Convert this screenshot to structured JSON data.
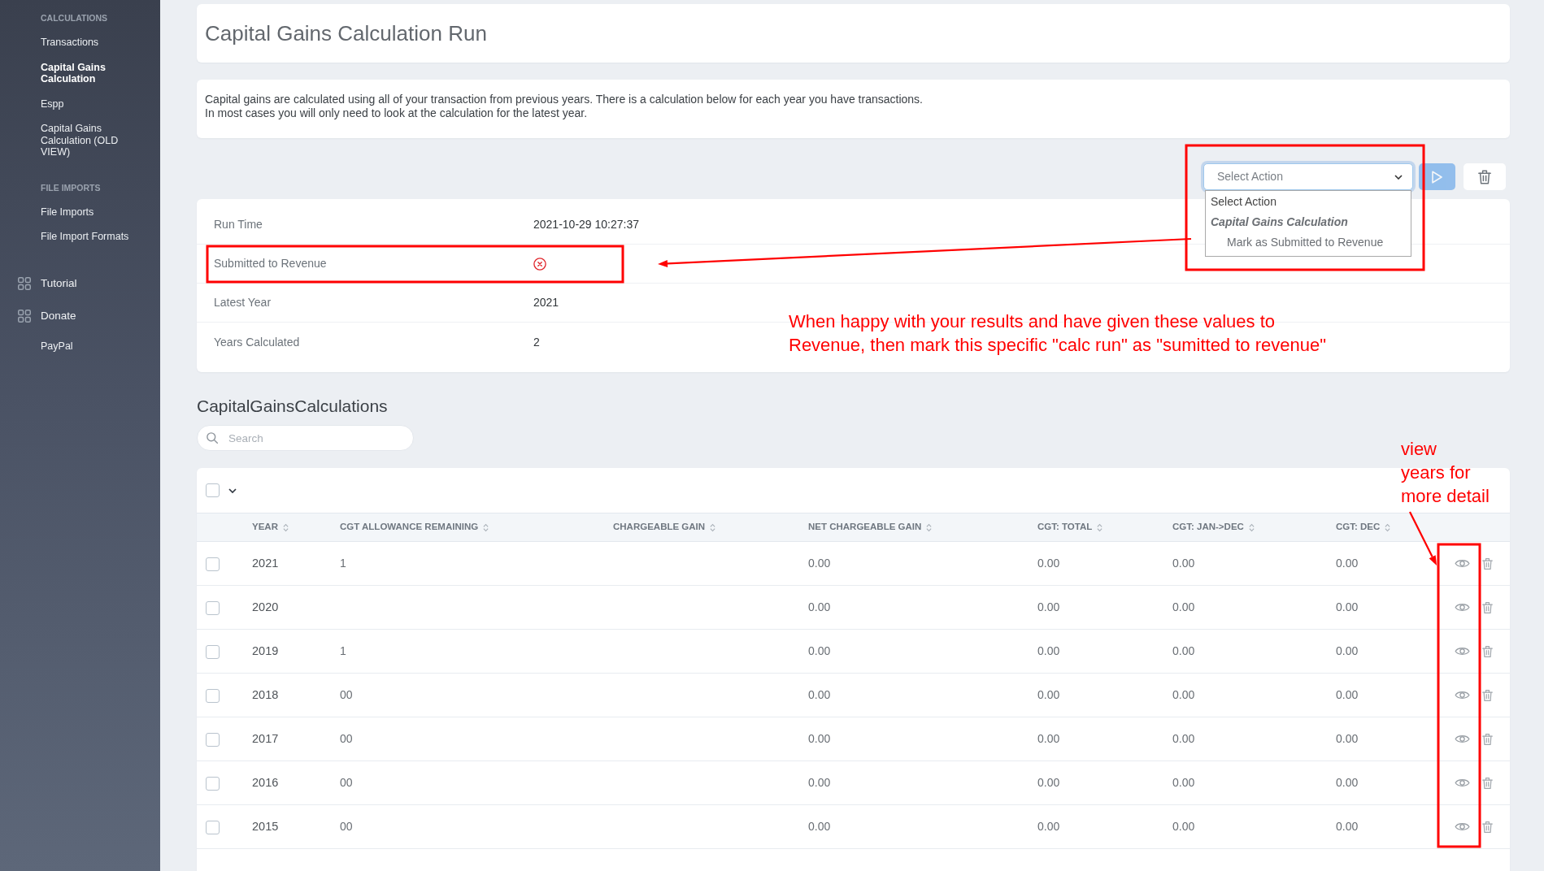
{
  "sidebar": {
    "sections": [
      {
        "heading": "CALCULATIONS",
        "items": [
          {
            "label": "Transactions",
            "selected": false
          },
          {
            "label": "Capital Gains Calculation",
            "selected": true
          },
          {
            "label": "Espp",
            "selected": false
          },
          {
            "label": "Capital Gains Calculation (OLD VIEW)",
            "selected": false
          }
        ]
      },
      {
        "heading": "FILE IMPORTS",
        "items": [
          {
            "label": "File Imports",
            "selected": false
          },
          {
            "label": "File Import Formats",
            "selected": false
          }
        ]
      }
    ],
    "menu": [
      {
        "label": "Tutorial",
        "selected": false
      },
      {
        "label": "Donate",
        "selected": false,
        "children": [
          {
            "label": "PayPal",
            "selected": false
          }
        ]
      }
    ]
  },
  "page_title": "Capital Gains Calculation Run",
  "description_lines": [
    "Capital gains are calculated using all of your transaction from previous years. There is a calculation below for each year you have transactions.",
    "In most cases you will only need to look at the calculation for the latest year."
  ],
  "action_bar": {
    "select": {
      "placeholder": "Select Action",
      "focused": true,
      "open": true,
      "options": [
        {
          "kind": "option",
          "label": "Select Action",
          "selected": false
        },
        {
          "kind": "group",
          "label": "Capital Gains Calculation",
          "children": [
            {
              "kind": "option",
              "label": "Mark as Submitted to Revenue",
              "selected": false
            }
          ]
        }
      ]
    },
    "run_button": {
      "disabled": true
    }
  },
  "info": {
    "rows": [
      {
        "kind": "text",
        "label": "Run Time",
        "value": "2021-10-29 10:27:37"
      },
      {
        "kind": "status",
        "label": "Submitted to Revenue",
        "submitted": false
      },
      {
        "kind": "text",
        "label": "Latest Year",
        "value": "2021"
      },
      {
        "kind": "text",
        "label": "Years Calculated",
        "value": "2"
      }
    ]
  },
  "calculations": {
    "heading": "CapitalGainsCalculations",
    "search": {
      "placeholder": "Search"
    },
    "select_all": {
      "checked": false
    },
    "columns": [
      "YEAR",
      "CGT ALLOWANCE REMAINING",
      "CHARGEABLE GAIN",
      "NET CHARGEABLE GAIN",
      "CGT: TOTAL",
      "CGT: JAN->DEC",
      "CGT: DEC"
    ],
    "rows": [
      {
        "checked": false,
        "year": "2021",
        "cgt_allowance_remaining": "1",
        "net_chargeable_gain": "0.00",
        "cgt_total": "0.00",
        "cgt_jan_dec": "0.00",
        "cgt_dec": "0.00"
      },
      {
        "checked": false,
        "year": "2020",
        "net_chargeable_gain": "0.00",
        "cgt_total": "0.00",
        "cgt_jan_dec": "0.00",
        "cgt_dec": "0.00"
      },
      {
        "checked": false,
        "year": "2019",
        "cgt_allowance_remaining": "1",
        "net_chargeable_gain": "0.00",
        "cgt_total": "0.00",
        "cgt_jan_dec": "0.00",
        "cgt_dec": "0.00"
      },
      {
        "checked": false,
        "year": "2018",
        "cgt_allowance_remaining": "00",
        "net_chargeable_gain": "0.00",
        "cgt_total": "0.00",
        "cgt_jan_dec": "0.00",
        "cgt_dec": "0.00"
      },
      {
        "checked": false,
        "year": "2017",
        "cgt_allowance_remaining": "00",
        "net_chargeable_gain": "0.00",
        "cgt_total": "0.00",
        "cgt_jan_dec": "0.00",
        "cgt_dec": "0.00"
      },
      {
        "checked": false,
        "year": "2016",
        "cgt_allowance_remaining": "00",
        "net_chargeable_gain": "0.00",
        "cgt_total": "0.00",
        "cgt_jan_dec": "0.00",
        "cgt_dec": "0.00"
      },
      {
        "checked": false,
        "year": "2015",
        "cgt_allowance_remaining": "00",
        "net_chargeable_gain": "0.00",
        "cgt_total": "0.00",
        "cgt_jan_dec": "0.00",
        "cgt_dec": "0.00"
      }
    ]
  },
  "annotations": [
    {
      "lines": [
        "When happy with your results and have given these values to",
        "Revenue, then mark this specific \"calc run\" as \"sumitted to revenue\""
      ]
    },
    {
      "lines": [
        "view",
        "years for",
        "more detail"
      ]
    }
  ]
}
